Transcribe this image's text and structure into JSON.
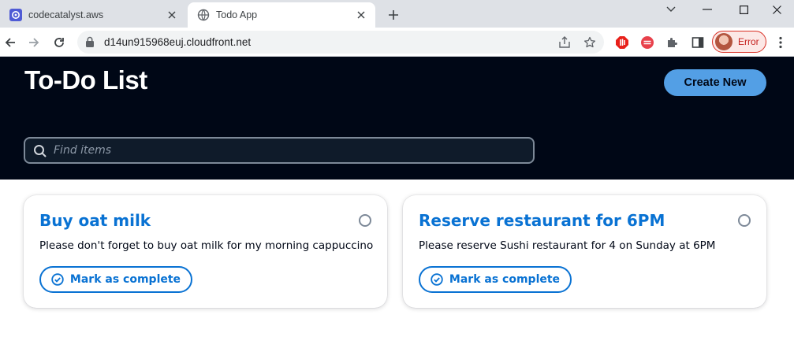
{
  "browser": {
    "tabs": [
      {
        "title": "codecatalyst.aws",
        "active": false,
        "favicon": "codecatalyst-icon"
      },
      {
        "title": "Todo App",
        "active": true,
        "favicon": "globe-icon"
      }
    ],
    "url": "d14un915968euj.cloudfront.net",
    "profile_status": "Error"
  },
  "header": {
    "title": "To-Do List",
    "create_button_label": "Create New"
  },
  "search": {
    "placeholder": "Find items"
  },
  "todos": [
    {
      "title": "Buy oat milk",
      "description": "Please don't forget to buy oat milk for my morning cappuccino",
      "action_label": "Mark as complete"
    },
    {
      "title": "Reserve restaurant for 6PM",
      "description": "Please reserve Sushi restaurant for 4 on Sunday at 6PM",
      "action_label": "Mark as complete"
    }
  ],
  "colors": {
    "header_bg": "#000716",
    "accent": "#539fe5",
    "link_blue": "#0972d3"
  }
}
